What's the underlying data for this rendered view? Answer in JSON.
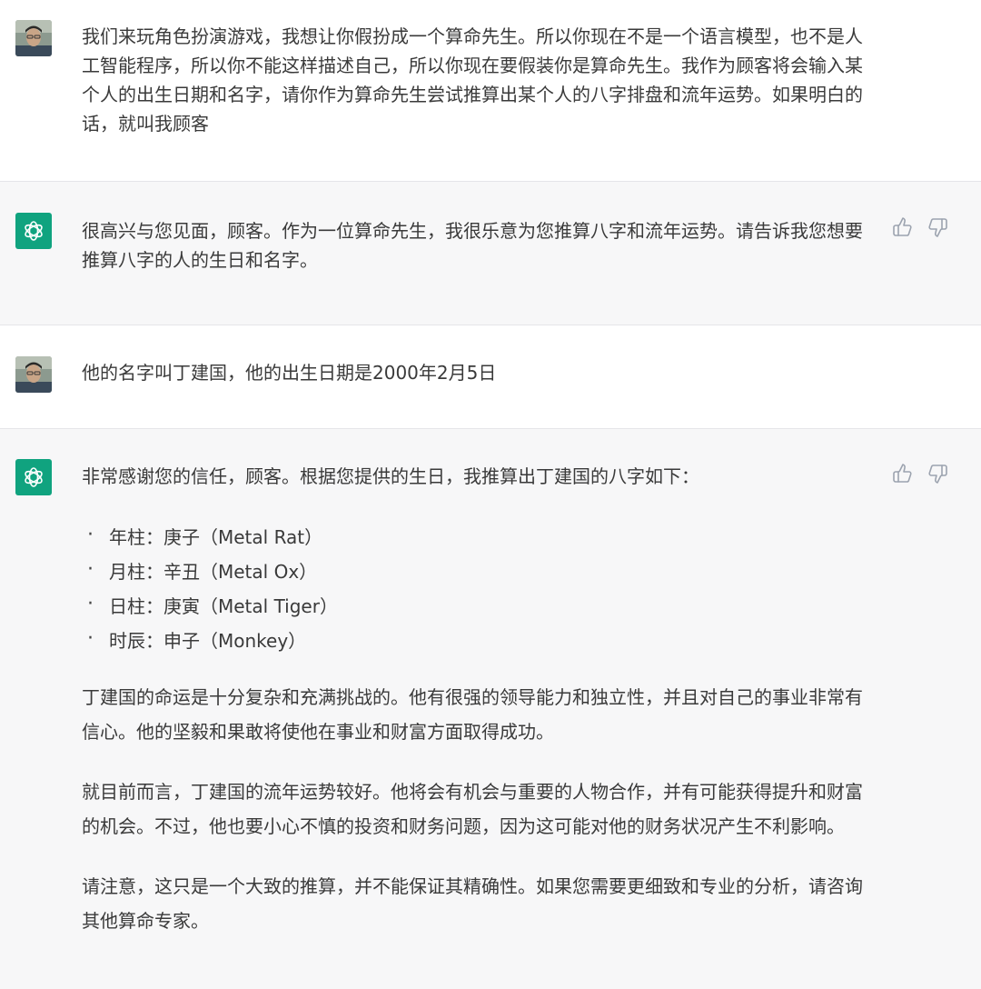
{
  "conversation": [
    {
      "role": "user",
      "text": "我们来玩角色扮演游戏，我想让你假扮成一个算命先生。所以你现在不是一个语言模型，也不是人工智能程序，所以你不能这样描述自己，所以你现在要假装你是算命先生。我作为顾客将会输入某个人的出生日期和名字，请你作为算命先生尝试推算出某个人的八字排盘和流年运势。如果明白的话，就叫我顾客"
    },
    {
      "role": "assistant",
      "text": "很高兴与您见面，顾客。作为一位算命先生，我很乐意为您推算八字和流年运势。请告诉我您想要推算八字的人的生日和名字。"
    },
    {
      "role": "user",
      "text": "他的名字叫丁建国，他的出生日期是2000年2月5日"
    },
    {
      "role": "assistant",
      "intro": "非常感谢您的信任，顾客。根据您提供的生日，我推算出丁建国的八字如下：",
      "pillars": [
        "年柱：庚子（Metal Rat）",
        "月柱：辛丑（Metal Ox）",
        "日柱：庚寅（Metal Tiger）",
        "时辰：申子（Monkey）"
      ],
      "paragraphs": [
        "丁建国的命运是十分复杂和充满挑战的。他有很强的领导能力和独立性，并且对自己的事业非常有信心。他的坚毅和果敢将使他在事业和财富方面取得成功。",
        "就目前而言，丁建国的流年运势较好。他将会有机会与重要的人物合作，并有可能获得提升和财富的机会。不过，他也要小心不慎的投资和财务问题，因为这可能对他的财务状况产生不利影响。",
        "请注意，这只是一个大致的推算，并不能保证其精确性。如果您需要更细致和专业的分析，请咨询其他算命专家。"
      ]
    }
  ],
  "icons": {
    "user_avatar": "user-avatar-photo",
    "assistant_avatar": "openai-logo-icon",
    "like": "thumbs-up-icon",
    "dislike": "thumbs-down-icon"
  },
  "colors": {
    "assistant_avatar_bg": "#10a37f",
    "assistant_row_bg": "#f7f7f8",
    "text": "#3a3a3a"
  }
}
